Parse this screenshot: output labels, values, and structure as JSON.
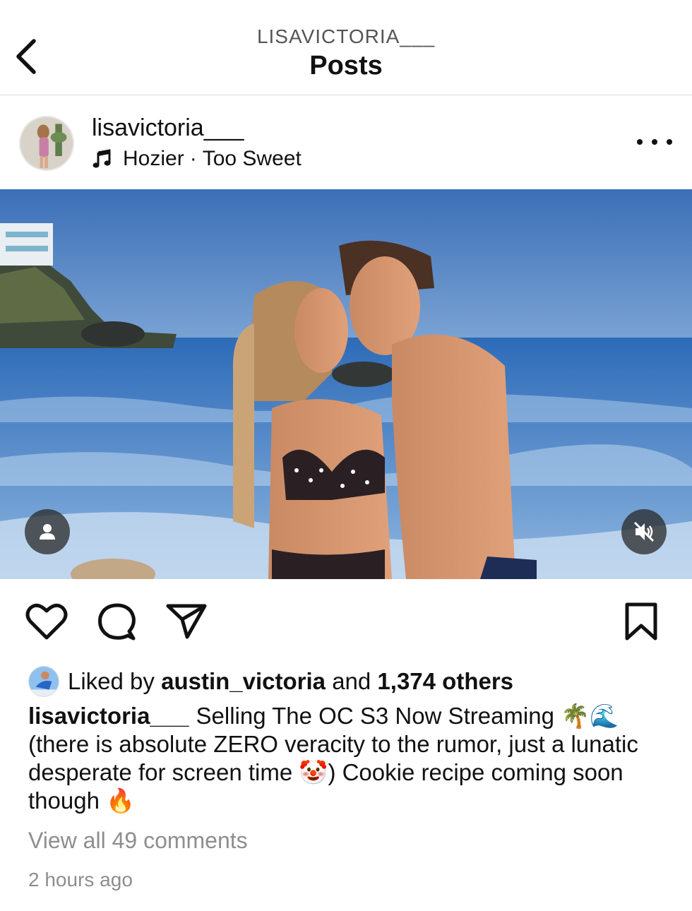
{
  "top_bar": {
    "username": "LISAVICTORIA___",
    "title": "Posts"
  },
  "post": {
    "username": "lisavictoria___",
    "audio": {
      "artist": "Hozier",
      "separator": "·",
      "track": "Too Sweet"
    }
  },
  "likes": {
    "prefix": "Liked by",
    "liker": "austin_victoria",
    "middle": "and",
    "count": "1,374 others"
  },
  "caption": {
    "username": "lisavictoria___",
    "text": "Selling The OC S3 Now Streaming 🌴🌊 (there is absolute ZERO veracity to the rumor, just a lunatic desperate for screen time 🤡) Cookie recipe coming soon though 🔥"
  },
  "comments_link": "View all 49 comments",
  "timestamp": "2 hours ago",
  "icons": {
    "back": "chevron-left-icon",
    "music": "music-note-icon",
    "more": "more-horizontal-icon",
    "tag": "user-tag-icon",
    "mute": "speaker-muted-icon",
    "like": "heart-icon",
    "comment": "comment-icon",
    "share": "send-icon",
    "save": "bookmark-icon"
  },
  "colors": {
    "text": "#111111",
    "secondary_text": "#8e8e8e",
    "divider": "#dcdcdc"
  }
}
